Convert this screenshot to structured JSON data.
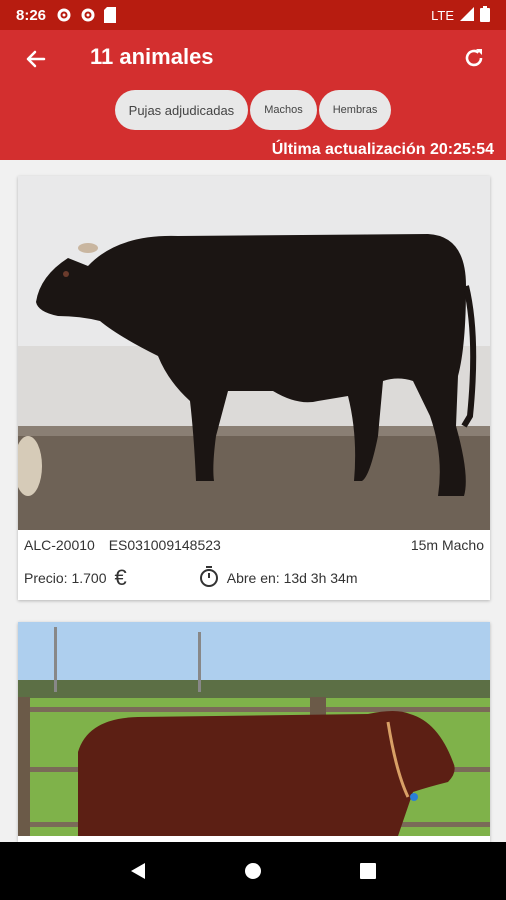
{
  "status": {
    "time": "8:26",
    "network": "LTE"
  },
  "header": {
    "title": "11 animales",
    "filters": [
      "Pujas adjudicadas",
      "Machos",
      "Hembras"
    ],
    "last_update": "Última actualización 20:25:54"
  },
  "cards": [
    {
      "code": "ALC-20010",
      "registry": "ES031009148523",
      "age_sex": "15m Macho",
      "price": "Precio: 1.700",
      "currency_symbol": "€",
      "opens": "Abre en: 13d 3h 34m"
    }
  ],
  "colors": {
    "primary": "#d32f2f",
    "status": "#b71c10"
  }
}
